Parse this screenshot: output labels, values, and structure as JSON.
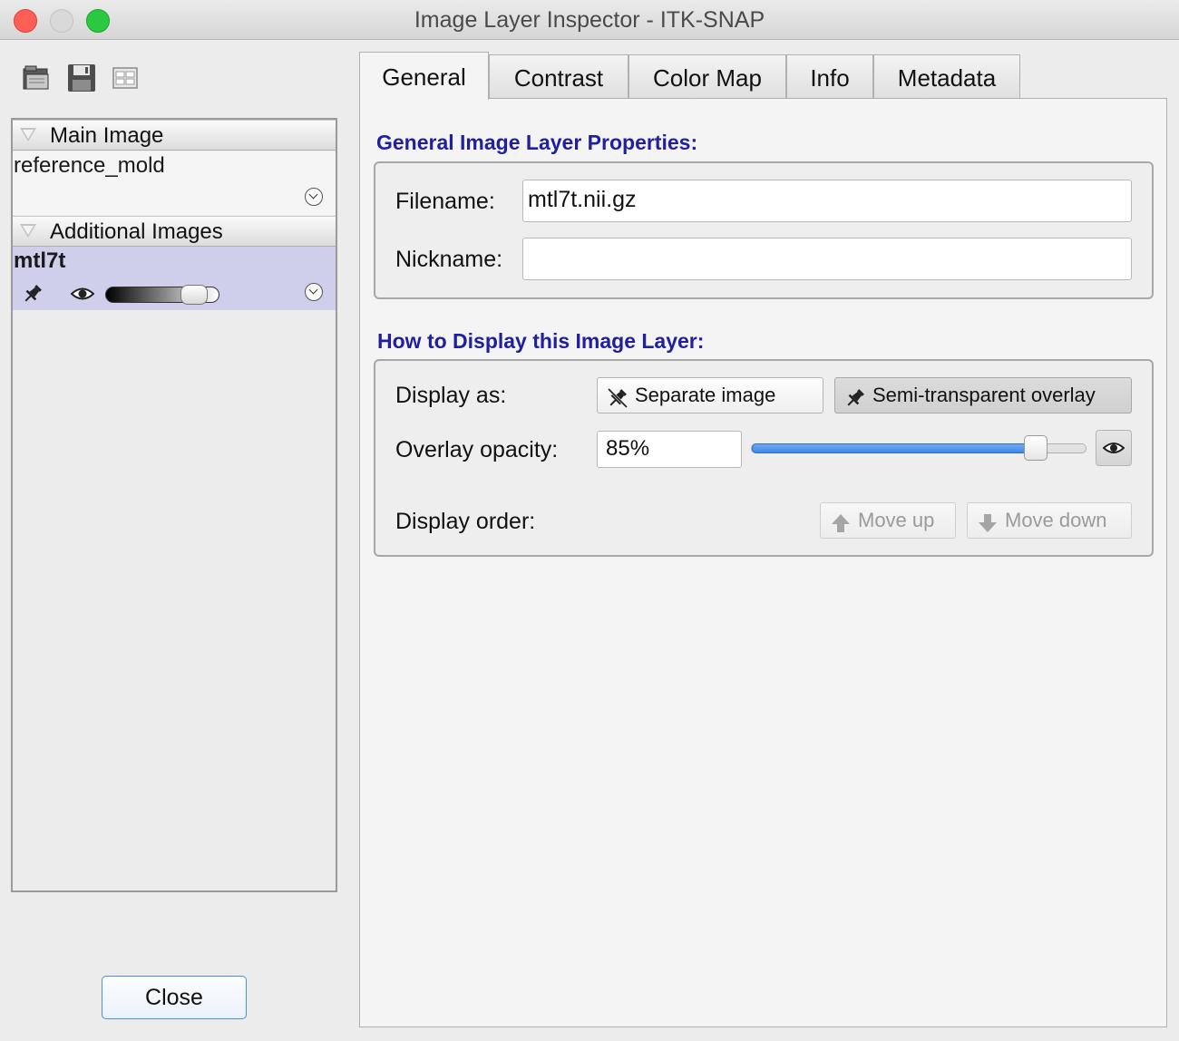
{
  "window": {
    "title": "Image Layer Inspector - ITK-SNAP"
  },
  "toolbar": {
    "icons": [
      "open-folder-icon",
      "save-icon",
      "layout-grid-icon"
    ]
  },
  "layers": {
    "main_group": {
      "label": "Main Image",
      "items": [
        {
          "name": "reference_mold"
        }
      ]
    },
    "additional_group": {
      "label": "Additional Images",
      "items": [
        {
          "name": "mtl7t",
          "selected": true,
          "pinned": true,
          "visible": true,
          "opacity_fraction": 0.85
        }
      ]
    }
  },
  "close_button": {
    "label": "Close"
  },
  "tabs": [
    {
      "label": "General",
      "active": true
    },
    {
      "label": "Contrast",
      "active": false
    },
    {
      "label": "Color Map",
      "active": false
    },
    {
      "label": "Info",
      "active": false
    },
    {
      "label": "Metadata",
      "active": false
    }
  ],
  "general": {
    "properties_title": "General Image Layer Properties:",
    "filename_label": "Filename:",
    "filename_value": "mtl7t.nii.gz",
    "nickname_label": "Nickname:",
    "nickname_value": "",
    "display_title": "How to Display this Image Layer:",
    "display_as_label": "Display as:",
    "separate_image_label": "Separate image",
    "overlay_label": "Semi-transparent overlay",
    "display_mode_selected": "Semi-transparent overlay",
    "opacity_label": "Overlay opacity:",
    "opacity_value": "85%",
    "opacity_fraction": 0.85,
    "display_order_label": "Display order:",
    "move_up_label": "Move up",
    "move_down_label": "Move down"
  },
  "colors": {
    "section_title": "#1f1fa0",
    "selection": "#cfcfeb",
    "slider_fill": "#3f86e8"
  }
}
